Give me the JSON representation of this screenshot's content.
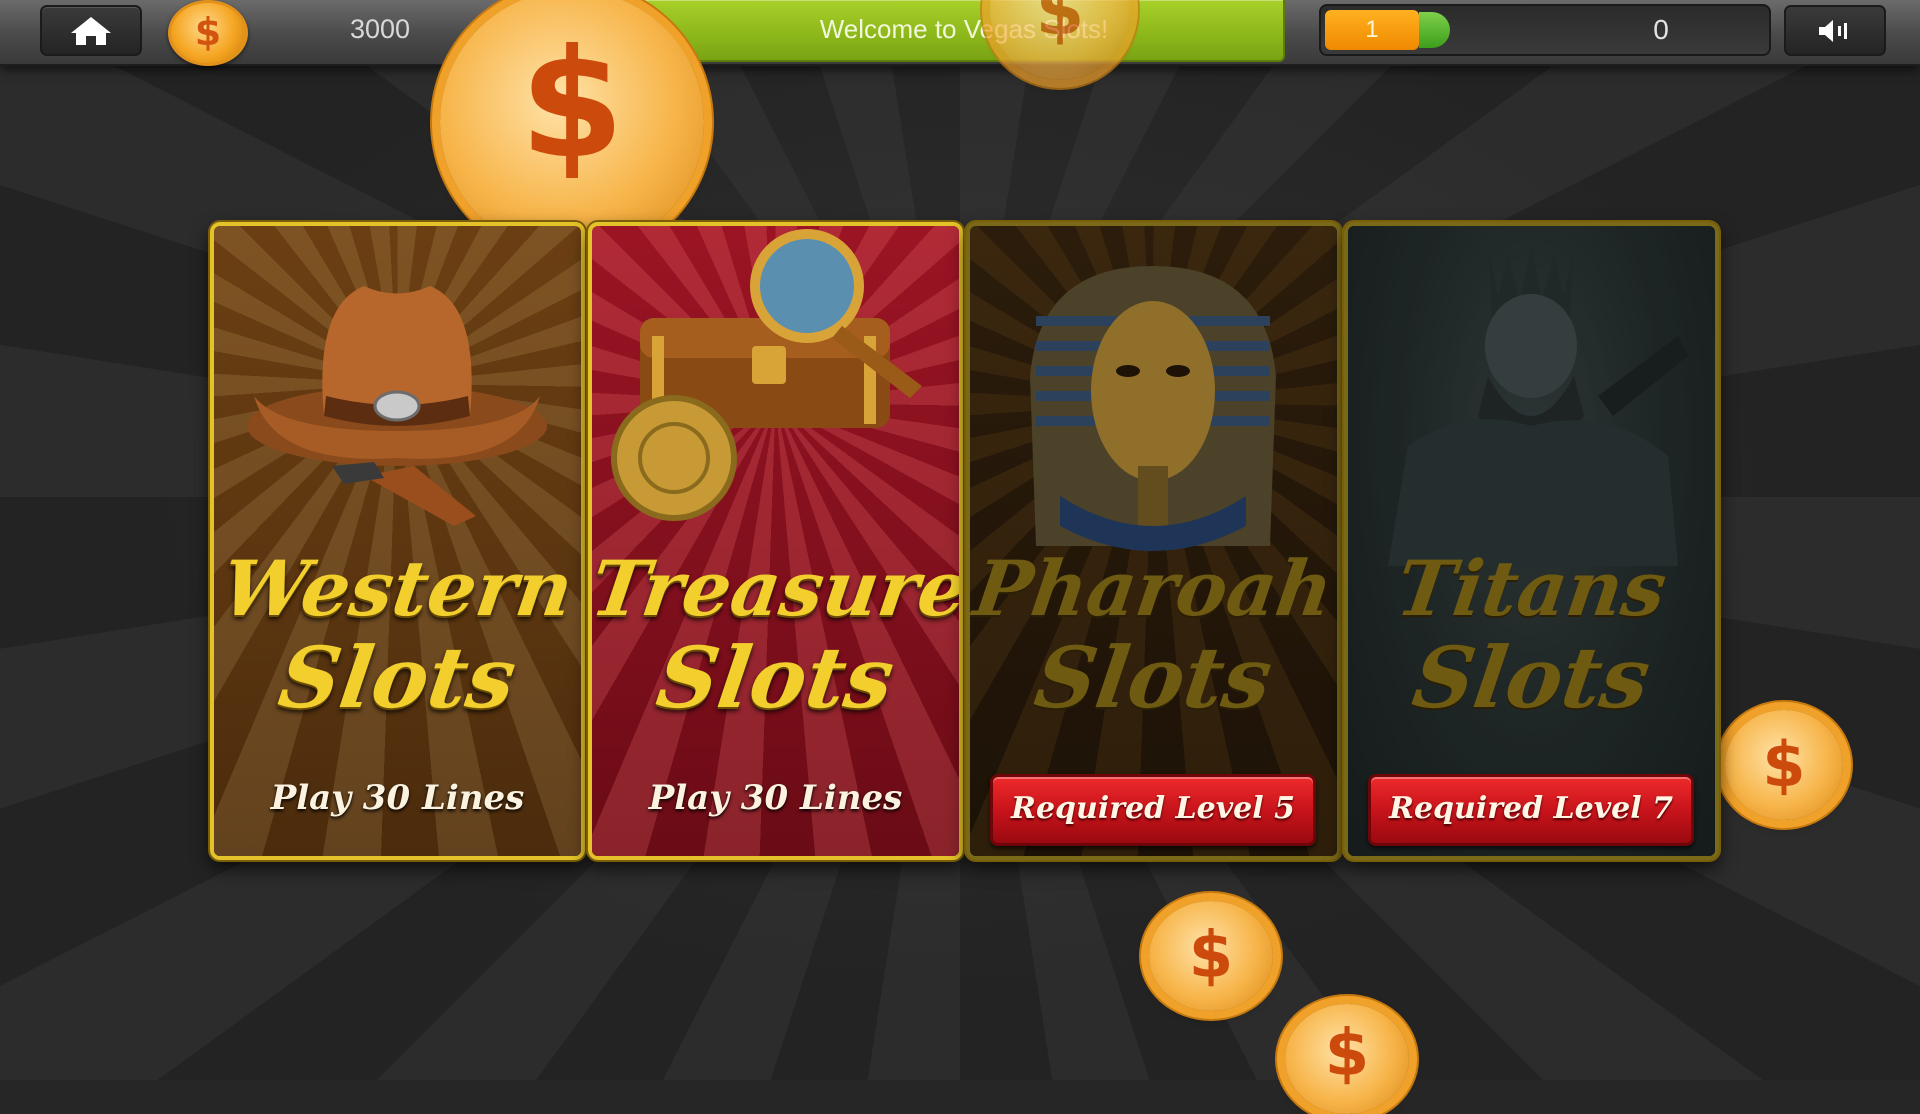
{
  "topbar": {
    "credits": "3000",
    "welcome": "Welcome to Vegas Slots!",
    "level": "1",
    "xp_progress": 0.07,
    "xp_value": "0",
    "coin_symbol": "$"
  },
  "coins": {
    "symbol": "$"
  },
  "cards": [
    {
      "title_line1": "Western",
      "title_line2": "Slots",
      "subtitle": "Play 30 Lines",
      "locked": false
    },
    {
      "title_line1": "Treasure",
      "title_line2": "Slots",
      "subtitle": "Play 30 Lines",
      "locked": false
    },
    {
      "title_line1": "Pharoah",
      "title_line2": "Slots",
      "subtitle": "Required Level 5",
      "locked": true
    },
    {
      "title_line1": "Titans",
      "title_line2": "Slots",
      "subtitle": "Required Level 7",
      "locked": true
    }
  ],
  "colors": {
    "accent_gold": "#e3c22a",
    "welcome_green": "#8cb71a",
    "level_orange": "#f08a00",
    "locked_red": "#c4121a"
  },
  "icons": [
    "home-icon",
    "dollar-coin-icon",
    "sound-icon"
  ]
}
